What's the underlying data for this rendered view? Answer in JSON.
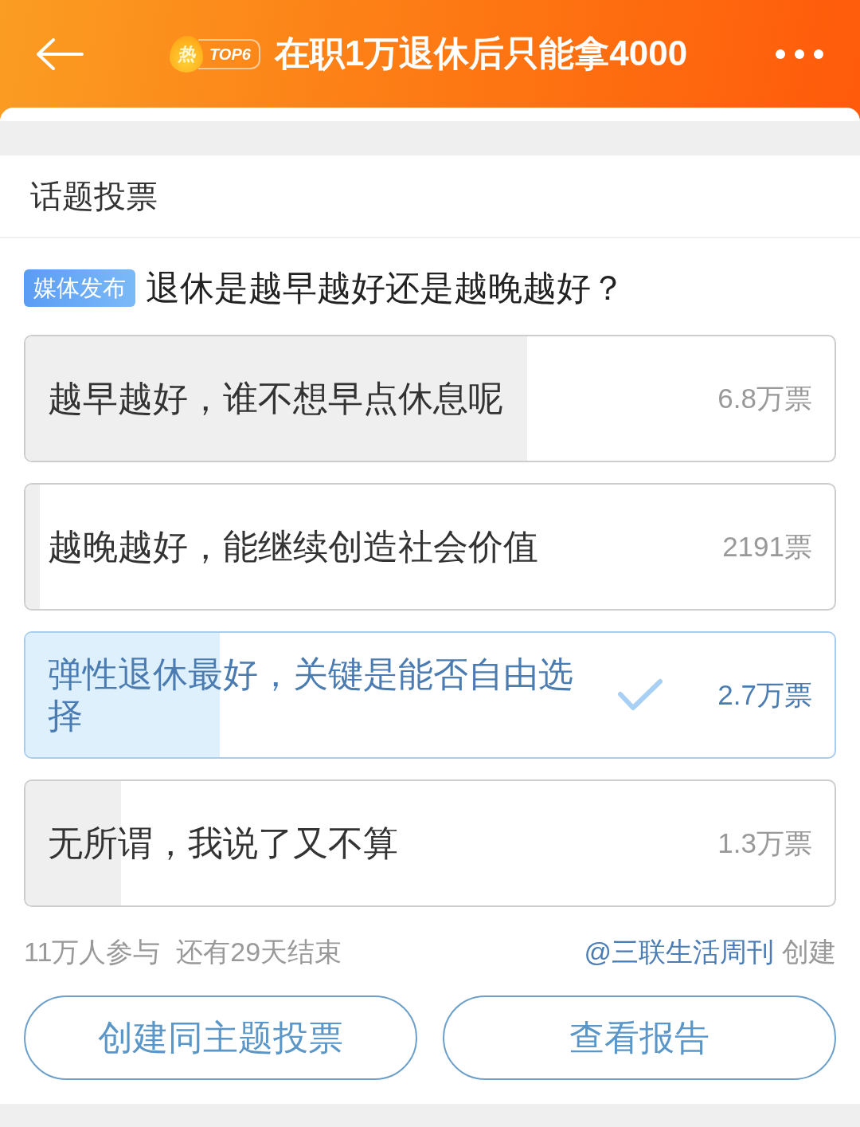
{
  "header": {
    "hot_label": "热",
    "rank": "TOP6",
    "title": "在职1万退休后只能拿4000"
  },
  "section_title": "话题投票",
  "poll": {
    "badge": "媒体发布",
    "question": "退休是越早越好还是越晚越好？",
    "options": [
      {
        "label": "越早越好，谁不想早点休息呢",
        "votes": "6.8万票",
        "level": 0.62,
        "selected": false
      },
      {
        "label": "越晚越好，能继续创造社会价值",
        "votes": "2191票",
        "level": 0.018,
        "selected": false
      },
      {
        "label": "弹性退休最好，关键是能否自由选择",
        "votes": "2.7万票",
        "level": 0.24,
        "selected": true
      },
      {
        "label": "无所谓，我说了又不算",
        "votes": "1.3万票",
        "level": 0.118,
        "selected": false
      }
    ],
    "participants": "11万人参与",
    "remaining": "还有29天结束",
    "creator": "@三联生活周刊",
    "creator_suffix": "创建"
  },
  "buttons": [
    {
      "label": "创建同主题投票"
    },
    {
      "label": "查看报告"
    }
  ]
}
